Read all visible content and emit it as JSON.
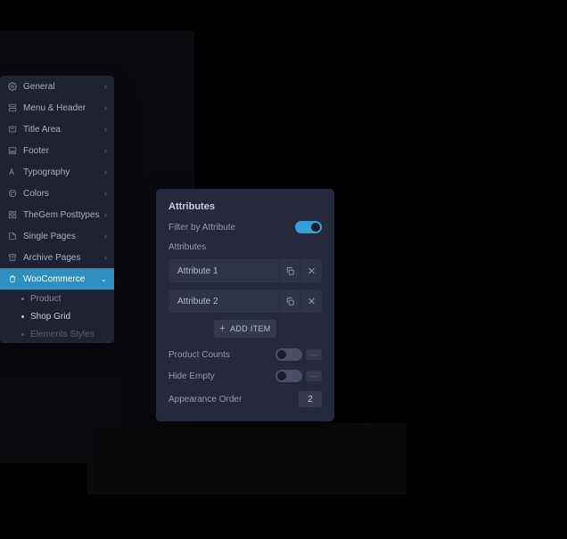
{
  "sidebar": {
    "items": [
      {
        "label": "General",
        "icon": "gear-icon"
      },
      {
        "label": "Menu & Header",
        "icon": "layout-icon"
      },
      {
        "label": "Title Area",
        "icon": "title-icon"
      },
      {
        "label": "Footer",
        "icon": "footer-icon"
      },
      {
        "label": "Typography",
        "icon": "text-icon"
      },
      {
        "label": "Colors",
        "icon": "palette-icon"
      },
      {
        "label": "TheGem Posttypes",
        "icon": "grid-icon"
      },
      {
        "label": "Single Pages",
        "icon": "page-icon"
      },
      {
        "label": "Archive Pages",
        "icon": "archive-icon"
      },
      {
        "label": "WooCommerce",
        "icon": "bag-icon",
        "active": true,
        "children": [
          {
            "label": "Product",
            "selected": false
          },
          {
            "label": "Shop Grid",
            "selected": true
          },
          {
            "label": "Elements Styles",
            "dim": true
          }
        ]
      }
    ]
  },
  "panel": {
    "title": "Attributes",
    "filter_label": "Filter by Attribute",
    "filter_on": true,
    "attributes_label": "Attributes",
    "items": [
      {
        "name": "Attribute 1"
      },
      {
        "name": "Attribute 2"
      }
    ],
    "add_label": "ADD ITEM",
    "product_counts_label": "Product Counts",
    "product_counts_on": false,
    "hide_empty_label": "Hide Empty",
    "hide_empty_on": false,
    "appearance_label": "Appearance Order",
    "appearance_value": "2"
  }
}
